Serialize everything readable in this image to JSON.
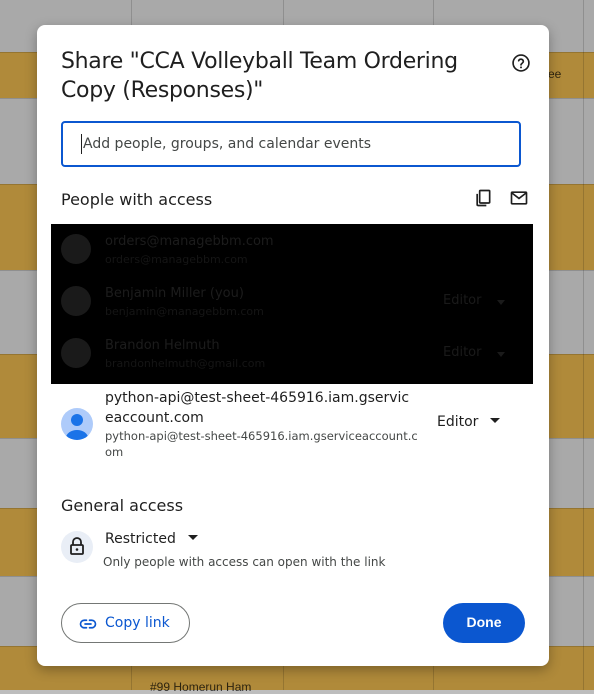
{
  "background": {
    "cell_text_right": "ee",
    "cell_text_bottom": "#99 Homerun Ham"
  },
  "dialog": {
    "title": "Share \"CCA Volleyball Team Ordering Copy (Responses)\"",
    "help_icon": "help-circle-icon",
    "search": {
      "placeholder": "Add people, groups, and calendar events",
      "value": ""
    },
    "people_section": {
      "title": "People with access",
      "copy_icon": "copy-icon",
      "email_icon": "mail-icon"
    },
    "redacted_people": [
      {
        "name": "orders@managebbm.com",
        "email": "orders@managebbm.com",
        "role": ""
      },
      {
        "name": "Benjamin Miller (you)",
        "email": "benjamin@managebbm.com",
        "role": "Editor"
      },
      {
        "name": "Brandon Helmuth",
        "email": "brandonhelmuth@gmail.com",
        "role": "Editor"
      }
    ],
    "person": {
      "name": "python-api@test-sheet-465916.iam.gserviceaccount.com",
      "email": "python-api@test-sheet-465916.iam.gserviceaccount.com",
      "role": "Editor"
    },
    "general_access": {
      "title": "General access",
      "level": "Restricted",
      "description": "Only people with access can open with the link"
    },
    "buttons": {
      "copy_link": "Copy link",
      "done": "Done"
    }
  },
  "colors": {
    "accent": "#0b57d0",
    "sheet_highlight": "#b08a3a",
    "avatar_bg": "#aecbfa"
  }
}
